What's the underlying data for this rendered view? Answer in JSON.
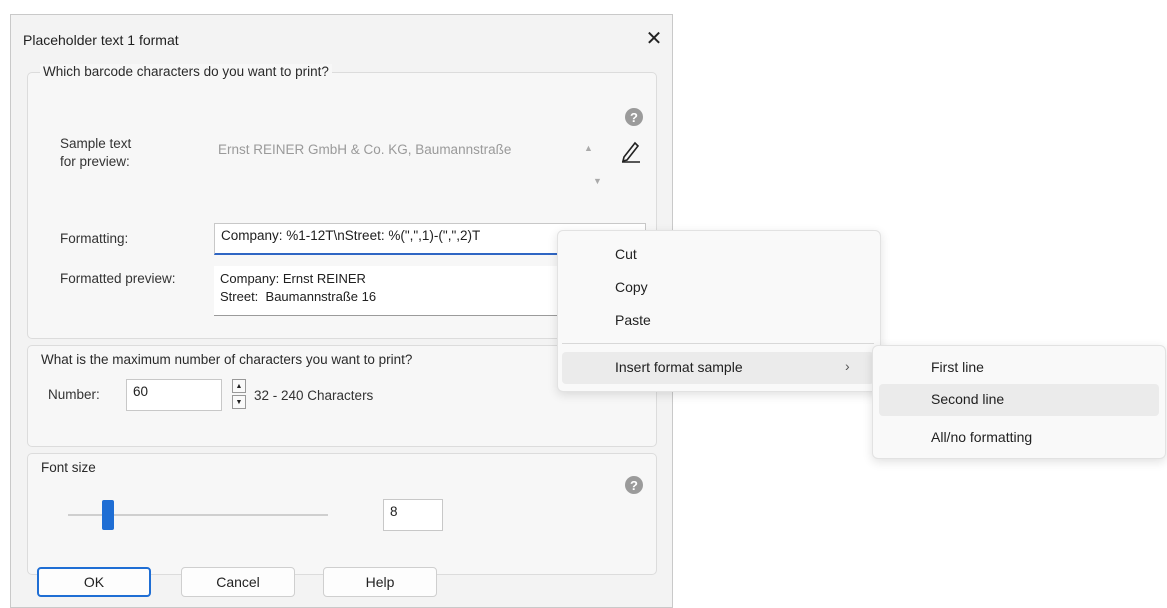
{
  "dialog": {
    "title": "Placeholder text 1 format",
    "close_glyph": "✕",
    "section_barcode": {
      "legend": "Which barcode characters do you want to print?",
      "sample_label_line1": "Sample text",
      "sample_label_line2": "for preview:",
      "sample_value": "Ernst REINER GmbH & Co. KG, Baumannstraße",
      "formatting_label": "Formatting:",
      "formatting_value": "Company: %1-12T\\nStreet: %(\",\",1)-(\",\",2)T",
      "preview_label": "Formatted preview:",
      "preview_line1": "Company: Ernst REINER",
      "preview_line2": "Street:  Baumannstraße 16"
    },
    "section_max": {
      "legend": "What is the maximum number of characters you want to print?",
      "number_label": "Number:",
      "number_value": "60",
      "range_text": "32 - 240 Characters"
    },
    "section_font": {
      "legend": "Font size",
      "value": "8",
      "slider_fraction": 0.1
    },
    "buttons": {
      "ok": "OK",
      "cancel": "Cancel",
      "help": "Help"
    },
    "help_glyph": "?"
  },
  "context_menu": {
    "items": [
      "Cut",
      "Copy",
      "Paste"
    ],
    "submenu_label": "Insert format sample",
    "submenu_chevron": "›"
  },
  "submenu": {
    "items": [
      "First line",
      "Second line",
      "All/no formatting"
    ],
    "highlighted": "Second line"
  },
  "colors": {
    "accent": "#1f6ed4",
    "dialog_bg": "#f3f3f3",
    "highlight": "#ebebeb"
  }
}
